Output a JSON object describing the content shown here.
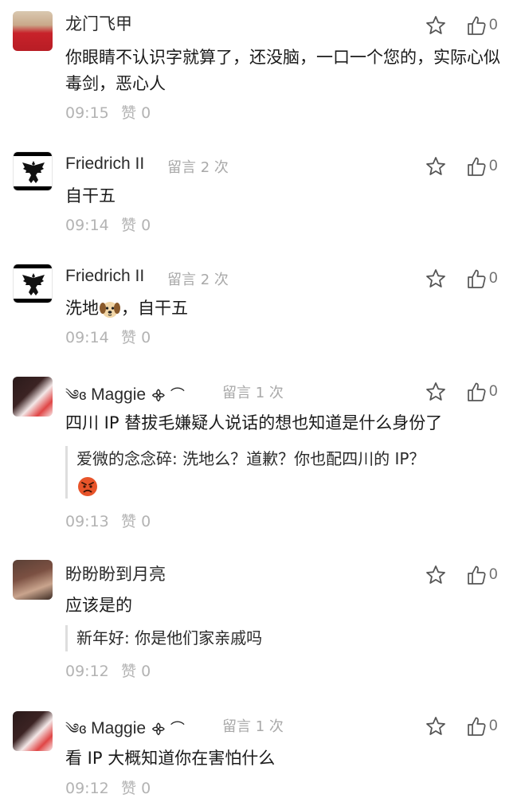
{
  "comments": [
    {
      "author": "龙门飞甲",
      "content": "你眼睛不认识字就算了，还没脑，一口一个您的，实际心似毒剑，恶心人",
      "time": "09:15",
      "like_label": "赞",
      "like_count": "0",
      "thumb_count": "0"
    },
    {
      "author": "Friedrich II",
      "msg_count": "留言 2 次",
      "content": "自干五",
      "time": "09:14",
      "like_label": "赞",
      "like_count": "0",
      "thumb_count": "0"
    },
    {
      "author": "Friedrich II",
      "msg_count": "留言 2 次",
      "content_before": "洗地",
      "content_after": "，自干五",
      "time": "09:14",
      "like_label": "赞",
      "like_count": "0",
      "thumb_count": "0"
    },
    {
      "author_prefix": "༄ɞ",
      "author": "Maggie",
      "author_suffix": "᯽ ⌒",
      "msg_count": "留言 1 次",
      "content": "四川 IP 替拔毛嫌疑人说话的想也知道是什么身份了",
      "quote": "爱微的念念碎: 洗地么？道歉？你也配四川的 IP？",
      "time": "09:13",
      "like_label": "赞",
      "like_count": "0",
      "thumb_count": "0"
    },
    {
      "author": "盼盼盼到月亮",
      "content": "应该是的",
      "quote": "新年好: 你是他们家亲戚吗",
      "time": "09:12",
      "like_label": "赞",
      "like_count": "0",
      "thumb_count": "0"
    },
    {
      "author_prefix": "༄ɞ",
      "author": "Maggie",
      "author_suffix": "᯽ ⌒",
      "msg_count": "留言 1 次",
      "content": "看 IP 大概知道你在害怕什么",
      "time": "09:12",
      "like_label": "赞",
      "like_count": "0",
      "thumb_count": "0"
    }
  ],
  "icons": {
    "star": "star-outline-icon",
    "thumb": "thumbs-up-outline-icon",
    "dog_emoji": "dog-face-emoji",
    "angry_emoji": "angry-face-emoji"
  }
}
